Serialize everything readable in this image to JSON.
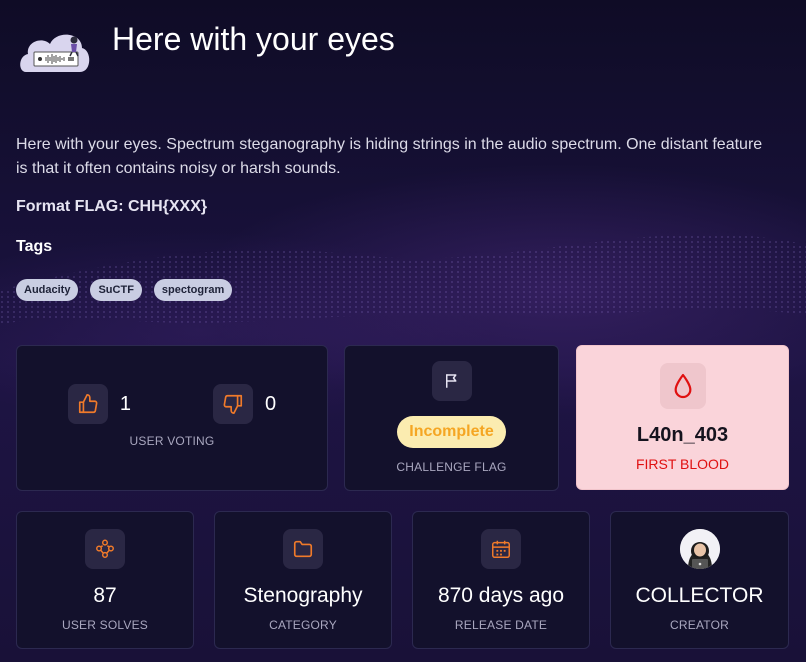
{
  "challenge": {
    "title": "Here with your eyes",
    "description": "Here with your eyes. Spectrum steganography is hiding strings in the audio spectrum. One distant feature is that it often contains noisy or harsh sounds.",
    "format": "Format FLAG: CHH{XXX}",
    "tags_heading": "Tags",
    "tags": [
      "Audacity",
      "SuCTF",
      "spectogram"
    ]
  },
  "voting": {
    "upvotes": "1",
    "downvotes": "0",
    "label": "USER VOTING"
  },
  "flag": {
    "status": "Incomplete",
    "label": "CHALLENGE FLAG"
  },
  "first_blood": {
    "user": "L40n_403",
    "label": "FIRST BLOOD"
  },
  "stats": [
    {
      "value": "87",
      "label": "USER SOLVES",
      "icon": "users-icon"
    },
    {
      "value": "Stenography",
      "label": "CATEGORY",
      "icon": "folder-icon"
    },
    {
      "value": "870 days ago",
      "label": "RELEASE DATE",
      "icon": "calendar-icon"
    },
    {
      "value": "COLLECTOR",
      "label": "CREATOR",
      "icon": "avatar"
    }
  ],
  "colors": {
    "accent_orange": "#f07a2a",
    "first_blood_red": "#e01010",
    "incomplete_text": "#f5a623",
    "incomplete_bg": "#fbecb0",
    "first_blood_bg": "#fad4da",
    "card_bg": "#13112c"
  }
}
